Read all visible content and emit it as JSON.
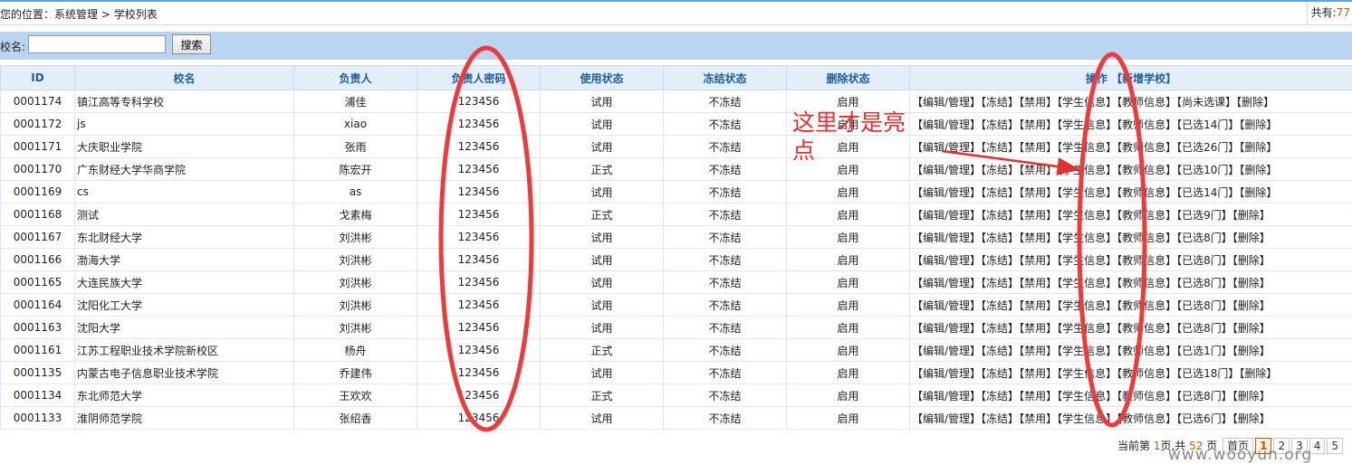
{
  "header": {
    "location_label": "您的位置：",
    "location_path": "系统管理 > 学校列表",
    "total_label": "共有:",
    "total_value": "77"
  },
  "search": {
    "label": "校名:",
    "value": "",
    "placeholder": "",
    "button": "搜索"
  },
  "table": {
    "columns": [
      "ID",
      "校名",
      "负责人",
      "负责人密码",
      "使用状态",
      "冻结状态",
      "删除状态",
      "操作",
      "【新增学校】"
    ],
    "rows": [
      {
        "id": "0001174",
        "name": "镇江高等专科学校",
        "owner": "浦佳",
        "password": "123456",
        "use": "试用",
        "freeze": "不冻结",
        "del": "启用",
        "course": "【尚未选课】"
      },
      {
        "id": "0001172",
        "name": "js",
        "owner": "xiao",
        "password": "123456",
        "use": "试用",
        "freeze": "不冻结",
        "del": "启用",
        "course": "【已选14门】"
      },
      {
        "id": "0001171",
        "name": "大庆职业学院",
        "owner": "张雨",
        "password": "123456",
        "use": "试用",
        "freeze": "不冻结",
        "del": "启用",
        "course": "【已选26门】"
      },
      {
        "id": "0001170",
        "name": "广东财经大学华商学院",
        "owner": "陈宏开",
        "password": "123456",
        "use": "正式",
        "freeze": "不冻结",
        "del": "启用",
        "course": "【已选10门】"
      },
      {
        "id": "0001169",
        "name": "cs",
        "owner": "as",
        "password": "123456",
        "use": "试用",
        "freeze": "不冻结",
        "del": "启用",
        "course": "【已选14门】"
      },
      {
        "id": "0001168",
        "name": "测试",
        "owner": "戈素梅",
        "password": "123456",
        "use": "正式",
        "freeze": "不冻结",
        "del": "启用",
        "course": "【已选9门】"
      },
      {
        "id": "0001167",
        "name": "东北财经大学",
        "owner": "刘洪彬",
        "password": "123456",
        "use": "试用",
        "freeze": "不冻结",
        "del": "启用",
        "course": "【已选8门】"
      },
      {
        "id": "0001166",
        "name": "渤海大学",
        "owner": "刘洪彬",
        "password": "123456",
        "use": "试用",
        "freeze": "不冻结",
        "del": "启用",
        "course": "【已选8门】"
      },
      {
        "id": "0001165",
        "name": "大连民族大学",
        "owner": "刘洪彬",
        "password": "123456",
        "use": "试用",
        "freeze": "不冻结",
        "del": "启用",
        "course": "【已选8门】"
      },
      {
        "id": "0001164",
        "name": "沈阳化工大学",
        "owner": "刘洪彬",
        "password": "123456",
        "use": "试用",
        "freeze": "不冻结",
        "del": "启用",
        "course": "【已选8门】"
      },
      {
        "id": "0001163",
        "name": "沈阳大学",
        "owner": "刘洪彬",
        "password": "123456",
        "use": "试用",
        "freeze": "不冻结",
        "del": "启用",
        "course": "【已选8门】"
      },
      {
        "id": "0001161",
        "name": "江苏工程职业技术学院新校区",
        "owner": "杨舟",
        "password": "123456",
        "use": "正式",
        "freeze": "不冻结",
        "del": "启用",
        "course": "【已选1门】"
      },
      {
        "id": "0001135",
        "name": "内蒙古电子信息职业技术学院",
        "owner": "乔建伟",
        "password": "123456",
        "use": "试用",
        "freeze": "不冻结",
        "del": "启用",
        "course": "【已选18门】"
      },
      {
        "id": "0001134",
        "name": "东北师范大学",
        "owner": "王欢欢",
        "password": "123456",
        "use": "正式",
        "freeze": "不冻结",
        "del": "启用",
        "course": "【已选8门】"
      },
      {
        "id": "0001133",
        "name": "淮阴师范学院",
        "owner": "张绍香",
        "password": "123456",
        "use": "试用",
        "freeze": "不冻结",
        "del": "启用",
        "course": "【已选6门】"
      }
    ],
    "ops": {
      "edit": "【编辑/管理】",
      "freeze": "【冻结】",
      "disable": "【禁用】",
      "students": "【学生信息】",
      "teachers": "【教师信息】",
      "delete": "【删除】"
    }
  },
  "pager": {
    "prefix": "当前第",
    "current": "1",
    "mid": "页,共",
    "total_pages": "52",
    "suffix": "页",
    "first": "首页",
    "pages": [
      "1",
      "2",
      "3",
      "4",
      "5"
    ]
  },
  "annotation": {
    "note": "这里才是亮点",
    "color": "#e52e2e"
  },
  "watermark": "www.wooyun.org",
  "colors": {
    "header_bg": "#e4eef9",
    "search_bg": "#b9d5f2",
    "accent": "#d35400"
  }
}
